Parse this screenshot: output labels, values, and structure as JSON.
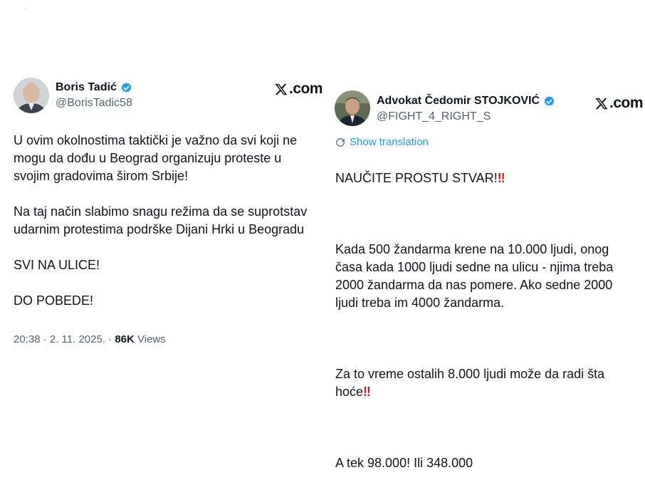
{
  "stray_mark": "'",
  "left_tweet": {
    "author_name": "Boris Tadić",
    "handle": "@BorisTadic58",
    "source_logo": "X.com",
    "text": "U ovim okolnostima taktički je važno da svi koji ne\nmogu da dođu u Beograd organizuju proteste u\nsvojim gradovima širom Srbije!\n\nNa taj način slabimo snagu režima da se suprotstav\nudarnim protestima podrške Dijani Hrki u Beogradu\n\nSVI NA ULICE!\n\nDO POBEDE!",
    "date": "20:38 · 2. 11. 2025. · ",
    "views_count": "86K",
    "views_label": " Views",
    "verified_icon": "verified-badge-icon",
    "avatar_icon": "profile-photo"
  },
  "right_tweet": {
    "author_name": "Advokat Čedomir STOJKOVIĆ",
    "handle": "@FIGHT_4_RIGHT_S",
    "source_logo": "X.com",
    "translate_label": "Show translation",
    "line1": "NAUČITE PROSTU STVAR!",
    "line1_emoji": "‼",
    "paragraph2": "Kada 500 žandarma krene na 10.000 ljudi, onog\nčasa kada 1000 ljudi sedne na ulicu - njima treba\n2000 žandarma da nas pomere. Ako sedne 2000\nljudi treba im 4000 žandarma.",
    "paragraph3": "Za to vreme ostalih 8.000 ljudi može da radi šta\nhoće",
    "paragraph3_emoji": "‼",
    "paragraph4": "A tek 98.000! Ili 348.000",
    "verified_icon": "verified-badge-icon",
    "avatar_icon": "profile-photo"
  },
  "colors": {
    "text": "#0f1419",
    "secondary": "#536471",
    "link": "#1d9bf0",
    "verified": "#1d9bf0",
    "emoji_red": "#d41a1a"
  }
}
